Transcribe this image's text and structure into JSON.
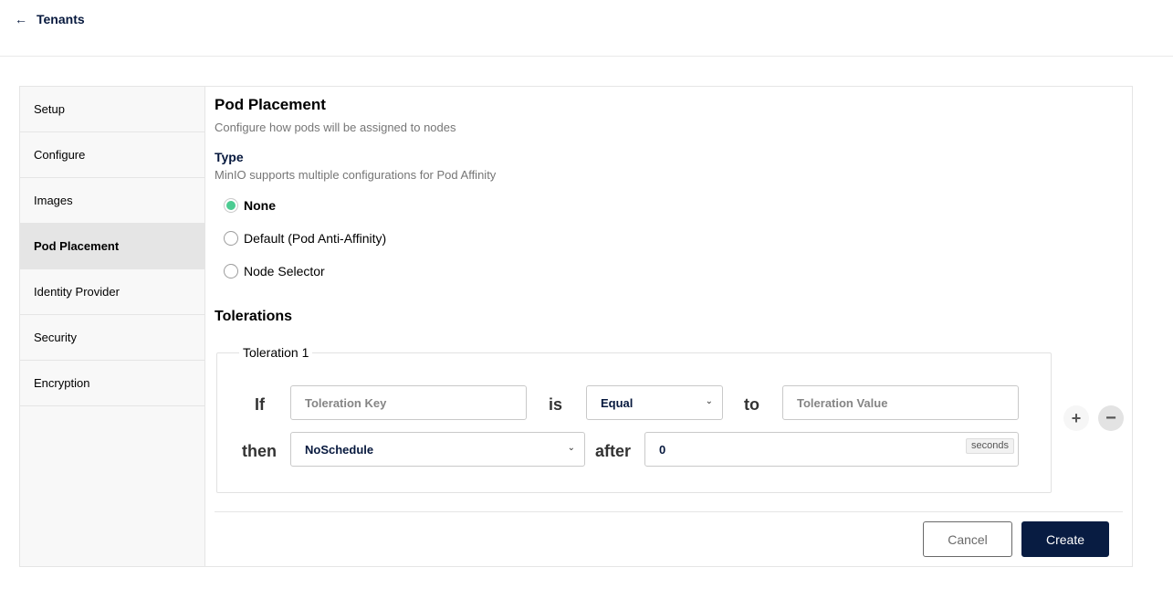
{
  "header": {
    "back_label": "Tenants",
    "back_icon": "arrow-left-icon"
  },
  "sidebar": {
    "items": [
      {
        "label": "Setup",
        "active": false
      },
      {
        "label": "Configure",
        "active": false
      },
      {
        "label": "Images",
        "active": false
      },
      {
        "label": "Pod Placement",
        "active": true
      },
      {
        "label": "Identity Provider",
        "active": false
      },
      {
        "label": "Security",
        "active": false
      },
      {
        "label": "Encryption",
        "active": false
      }
    ]
  },
  "main": {
    "title": "Pod Placement",
    "description": "Configure how pods will be assigned to nodes",
    "type_title": "Type",
    "type_description": "MinIO supports multiple configurations for Pod Affinity",
    "options": [
      {
        "label": "None",
        "selected": true
      },
      {
        "label": "Default (Pod Anti-Affinity)",
        "selected": false
      },
      {
        "label": "Node Selector",
        "selected": false
      }
    ],
    "tolerations_title": "Tolerations",
    "toleration": {
      "legend": "Toleration 1",
      "if_word": "If",
      "is_word": "is",
      "to_word": "to",
      "then_word": "then",
      "after_word": "after",
      "key_placeholder": "Toleration Key",
      "key_value": "",
      "operator": "Equal",
      "value_placeholder": "Toleration Value",
      "value_value": "",
      "effect": "NoSchedule",
      "seconds_value": "0",
      "seconds_unit": "seconds"
    }
  },
  "footer": {
    "cancel_label": "Cancel",
    "create_label": "Create"
  },
  "colors": {
    "accent": "#4ccb92",
    "primary_button": "#081c42"
  }
}
